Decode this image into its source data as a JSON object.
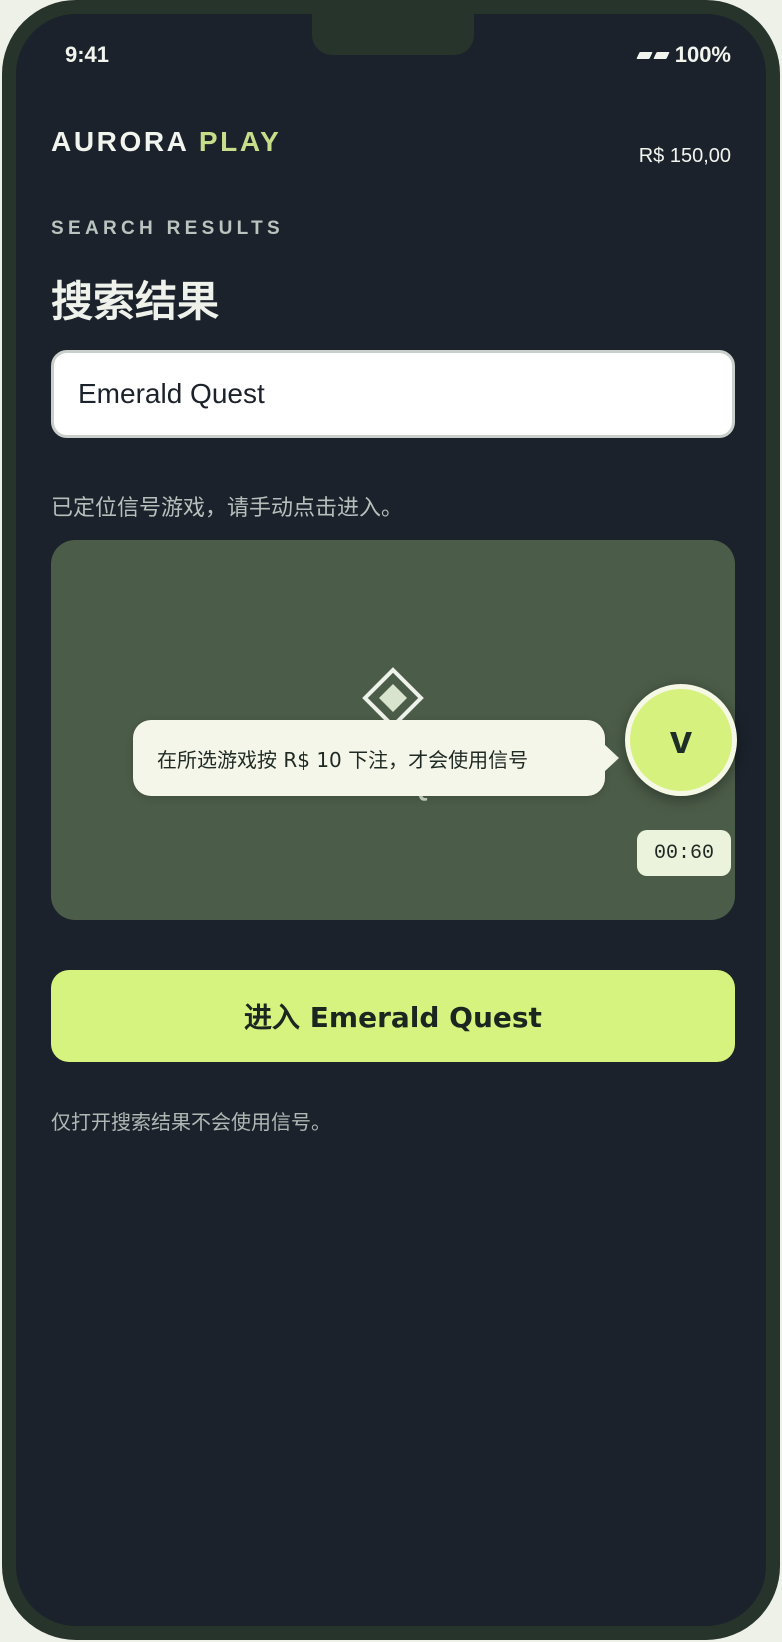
{
  "status_bar": {
    "time": "9:41",
    "battery": "100%"
  },
  "header": {
    "brand_primary": "AURORA",
    "brand_accent": "PLAY",
    "balance": "R$ 150,00"
  },
  "page": {
    "eyebrow": "SEARCH RESULTS",
    "title": "搜索结果"
  },
  "search": {
    "value": "Emerald Quest"
  },
  "helper_text": "已定位信号游戏，请手动点击进入。",
  "game_card": {
    "title": "Emerald Quest",
    "icon": "diamond-icon"
  },
  "signal_overlay": {
    "tooltip": "在所选游戏按 R$ 10 下注，才会使用信号",
    "badge_letter": "v",
    "timer": "00:60"
  },
  "cta": {
    "label": "进入 Emerald Quest"
  },
  "footnote": "仅打开搜索结果不会使用信号。",
  "colors": {
    "background": "#1b222b",
    "frame": "#27342b",
    "accent": "#d5f37e",
    "brand_accent": "#c6de8a",
    "card": "#4b5c48"
  }
}
